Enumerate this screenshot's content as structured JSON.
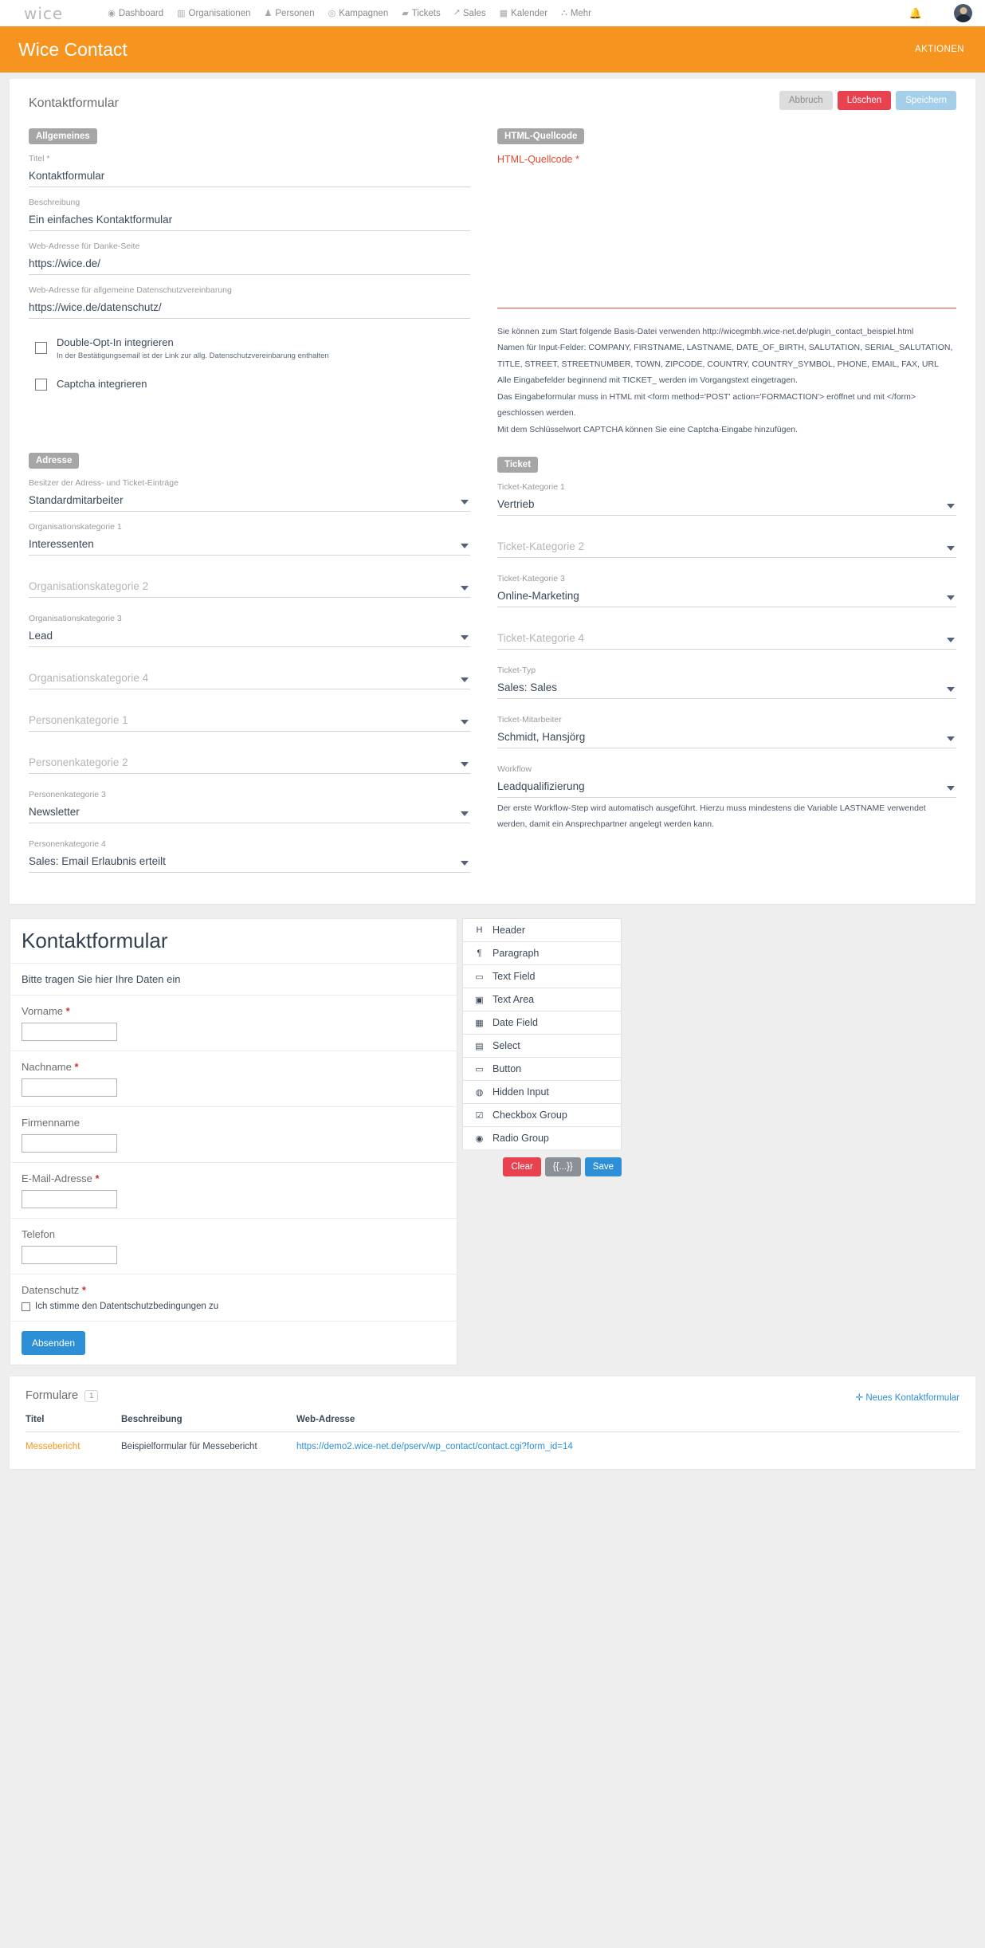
{
  "navbar": {
    "brand": "wice",
    "items": [
      {
        "label": "Dashboard",
        "icon": "dashboard-icon",
        "glyph": "◉"
      },
      {
        "label": "Organisationen",
        "icon": "building-icon",
        "glyph": "▤"
      },
      {
        "label": "Personen",
        "icon": "person-icon",
        "glyph": "♟"
      },
      {
        "label": "Kampagnen",
        "icon": "target-icon",
        "glyph": "◎"
      },
      {
        "label": "Tickets",
        "icon": "briefcase-icon",
        "glyph": "▰"
      },
      {
        "label": "Sales",
        "icon": "trend-up-icon",
        "glyph": "📈"
      },
      {
        "label": "Kalender",
        "icon": "calendar-icon",
        "glyph": "▦"
      },
      {
        "label": "Mehr",
        "icon": "sitemap-icon",
        "glyph": "⛫"
      }
    ],
    "bell_icon": "notification-bell-icon"
  },
  "header": {
    "title": "Wice Contact",
    "actions": "AKTIONEN"
  },
  "card": {
    "title": "Kontaktformular",
    "buttons": {
      "cancel": "Abbruch",
      "delete": "Löschen",
      "save": "Speichern"
    }
  },
  "general": {
    "badge": "Allgemeines",
    "title_label": "Titel *",
    "title_value": "Kontaktformular",
    "desc_label": "Beschreibung",
    "desc_value": "Ein einfaches Kontaktformular",
    "thanks_label": "Web-Adresse für Danke-Seite",
    "thanks_value": "https://wice.de/",
    "privacy_label": "Web-Adresse für allgemeine Datenschutzvereinbarung",
    "privacy_value": "https://wice.de/datenschutz/",
    "optin_label": "Double-Opt-In integrieren",
    "optin_sub": "In der Bestätigungsemail ist der Link zur allg. Datenschutzvereinbarung enthalten",
    "captcha_label": "Captcha integrieren"
  },
  "html_source": {
    "badge": "HTML-Quellcode",
    "label": "HTML-Quellcode *",
    "value": "",
    "help_lines": [
      "Sie können zum Start folgende Basis-Datei verwenden http://wicegmbh.wice-net.de/plugin_contact_beispiel.html",
      "Namen für Input-Felder: COMPANY, FIRSTNAME, LASTNAME, DATE_OF_BIRTH, SALUTATION, SERIAL_SALUTATION, TITLE, STREET, STREETNUMBER, TOWN, ZIPCODE, COUNTRY, COUNTRY_SYMBOL, PHONE, EMAIL, FAX, URL",
      "Alle Eingabefelder beginnend mit TICKET_ werden im Vorgangstext eingetragen.",
      "Das Eingabeformular muss in HTML mit <form method='POST' action='FORMACTION'> eröffnet und mit </form> geschlossen werden.",
      "Mit dem Schlüsselwort CAPTCHA können Sie eine Captcha-Eingabe hinzufügen."
    ]
  },
  "address": {
    "badge": "Adresse",
    "fields": [
      {
        "label": "Besitzer der Adress- und Ticket-Einträge",
        "value": "Standardmitarbeiter",
        "empty": false
      },
      {
        "label": "Organisationskategorie 1",
        "value": "Interessenten",
        "empty": false
      },
      {
        "label": "Organisationskategorie 2",
        "value": "",
        "empty": true
      },
      {
        "label": "Organisationskategorie 3",
        "value": "Lead",
        "empty": false
      },
      {
        "label": "Organisationskategorie 4",
        "value": "",
        "empty": true
      },
      {
        "label": "Personenkategorie 1",
        "value": "",
        "empty": true
      },
      {
        "label": "Personenkategorie 2",
        "value": "",
        "empty": true
      },
      {
        "label": "Personenkategorie 3",
        "value": "Newsletter",
        "empty": false
      },
      {
        "label": "Personenkategorie 4",
        "value": "Sales: Email Erlaubnis erteilt",
        "empty": false
      }
    ]
  },
  "ticket": {
    "badge": "Ticket",
    "fields": [
      {
        "label": "Ticket-Kategorie 1",
        "value": "Vertrieb",
        "empty": false
      },
      {
        "label": "Ticket-Kategorie 2",
        "value": "",
        "empty": true
      },
      {
        "label": "Ticket-Kategorie 3",
        "value": "Online-Marketing",
        "empty": false
      },
      {
        "label": "Ticket-Kategorie 4",
        "value": "",
        "empty": true
      },
      {
        "label": "Ticket-Typ",
        "value": "Sales: Sales",
        "empty": false
      },
      {
        "label": "Ticket-Mitarbeiter",
        "value": "Schmidt, Hansjörg",
        "empty": false
      },
      {
        "label": "Workflow",
        "value": "Leadqualifizierung",
        "empty": false
      }
    ],
    "workflow_help": "Der erste Workflow-Step wird automatisch ausgeführt. Hierzu muss mindestens die Variable LASTNAME verwendet werden, damit ein Ansprechpartner angelegt werden kann."
  },
  "builder": {
    "form_title": "Kontaktformular",
    "form_paragraph": "Bitte tragen Sie hier Ihre Daten ein",
    "fields": [
      {
        "label": "Vorname",
        "required": true
      },
      {
        "label": "Nachname",
        "required": true
      },
      {
        "label": "Firmenname",
        "required": false
      },
      {
        "label": "E-Mail-Adresse",
        "required": true
      },
      {
        "label": "Telefon",
        "required": false
      }
    ],
    "privacy_label": "Datenschutz",
    "privacy_required": true,
    "privacy_checkbox_text": "Ich stimme den Datentschutzbedingungen zu",
    "submit_label": "Absenden",
    "palette": [
      {
        "label": "Header",
        "icon": "header-h-icon",
        "glyph": "H"
      },
      {
        "label": "Paragraph",
        "icon": "paragraph-icon",
        "glyph": "¶"
      },
      {
        "label": "Text Field",
        "icon": "text-field-icon",
        "glyph": "▭"
      },
      {
        "label": "Text Area",
        "icon": "text-area-icon",
        "glyph": "▣"
      },
      {
        "label": "Date Field",
        "icon": "calendar-icon",
        "glyph": "▦"
      },
      {
        "label": "Select",
        "icon": "select-list-icon",
        "glyph": "▤"
      },
      {
        "label": "Button",
        "icon": "button-icon",
        "glyph": "▭"
      },
      {
        "label": "Hidden Input",
        "icon": "eye-slash-icon",
        "glyph": "◍"
      },
      {
        "label": "Checkbox Group",
        "icon": "checkbox-icon",
        "glyph": "☑"
      },
      {
        "label": "Radio Group",
        "icon": "radio-button-icon",
        "glyph": "◉"
      }
    ],
    "palette_buttons": {
      "clear": "Clear",
      "json": "{{...}}",
      "save": "Save"
    }
  },
  "list": {
    "title": "Formulare",
    "count": "1",
    "new_label": "Neues Kontaktformular",
    "new_icon": "plus-icon",
    "columns": [
      "Titel",
      "Beschreibung",
      "Web-Adresse"
    ],
    "rows": [
      {
        "titel": "Messebericht",
        "beschreibung": "Beispielformular für Messebericht",
        "url": "https://demo2.wice-net.de/pserv/wp_contact/contact.cgi?form_id=14"
      }
    ]
  },
  "colors": {
    "brand_orange": "#f79420",
    "accent_blue": "#2d8fd5",
    "danger_red": "#e8414f",
    "required_red": "#cc3333",
    "source_underline": "#e2522e"
  }
}
